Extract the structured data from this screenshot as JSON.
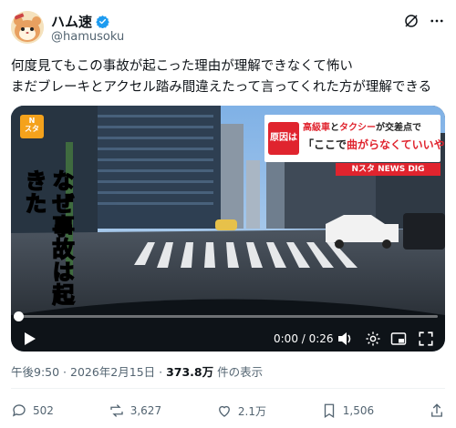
{
  "author": {
    "name": "ハム速",
    "handle": "@hamusoku"
  },
  "tweet": {
    "line1": "何度見てもこの事故が起こった理由が理解できなくて怖い",
    "line2": "まだブレーキとアクセル踏み間違えたって言ってくれた方が理解できる"
  },
  "video": {
    "logo_text": "N\nスタ",
    "caption_tag": "原因は",
    "caption_top": {
      "p1": "高級車",
      "p2": "と",
      "p3": "タクシー",
      "p4": "が交差点で"
    },
    "caption_bottom": {
      "p1": "「ここで",
      "p2": "曲がらなくていいや",
      "p3": "」"
    },
    "brand": "Nスタ NEWS DIG",
    "vertical_text": "なぜ事故は起きた",
    "time_display": "0:00 / 0:26",
    "progress_fraction": 0.0
  },
  "meta": {
    "time": "午後9:50",
    "sep1": " · ",
    "date": "2026年2月15日",
    "sep2": " · ",
    "views": "373.8万",
    "views_label": " 件の表示"
  },
  "actions": {
    "replies": "502",
    "reposts": "3,627",
    "likes": "2.1万",
    "bookmarks": "1,506"
  },
  "colors": {
    "accent": "#1d9bf0",
    "caption_red": "#e0242e",
    "vertical_yellow": "#ffe600"
  }
}
